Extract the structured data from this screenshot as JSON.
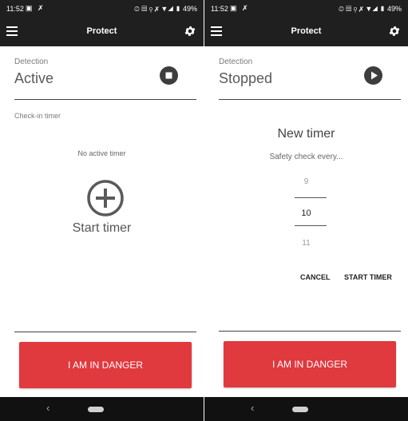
{
  "status_bar": {
    "time": "11:52",
    "left_icons": "▣ ✗",
    "right_icons": "⏲ ▤ ⚲ ✗ ▼◢ ▮ 49%"
  },
  "app_bar": {
    "title": "Protect"
  },
  "left_screen": {
    "detection_label": "Detection",
    "detection_state": "Active",
    "checkin_label": "Check-in timer",
    "no_timer_text": "No active timer",
    "start_timer_label": "Start timer",
    "danger_button": "I AM IN DANGER"
  },
  "right_screen": {
    "detection_label": "Detection",
    "detection_state": "Stopped",
    "dialog_title": "New timer",
    "dialog_subtitle": "Safety check every...",
    "picker_values": [
      "9",
      "10",
      "11"
    ],
    "cancel_button": "CANCEL",
    "start_button": "START TIMER",
    "danger_button": "I AM IN DANGER"
  },
  "colors": {
    "danger": "#e0393e",
    "bar": "#1f1f1f"
  }
}
